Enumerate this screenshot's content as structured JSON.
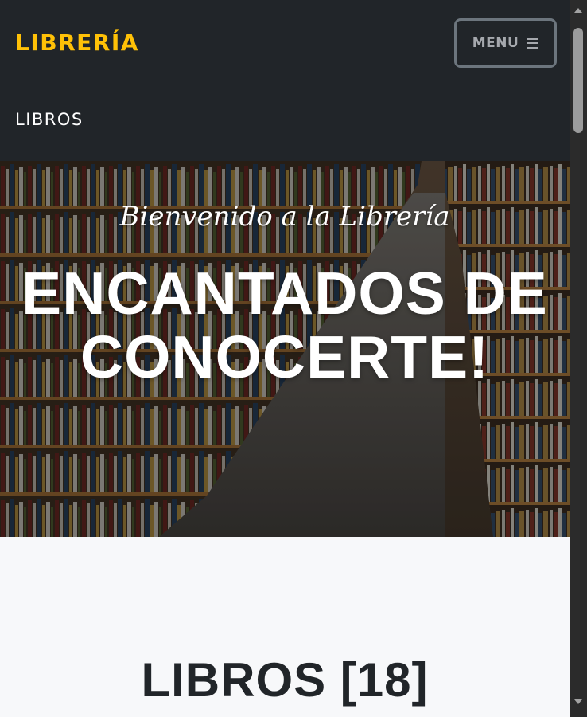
{
  "navbar": {
    "brand": "LIBRERÍA",
    "menu_label": "MENU",
    "menu_icon": "hamburger-icon",
    "links": [
      {
        "label": "LIBROS"
      }
    ]
  },
  "hero": {
    "subtitle": "Bienvenido a la Librería",
    "heading": "ENCANTADOS DE CONOCERTE!",
    "background": "bookstore aisle with shelves"
  },
  "section": {
    "title": "LIBROS [18]"
  },
  "colors": {
    "navbar_bg": "#212529",
    "brand": "#ffc107",
    "menu_border": "#6c757d",
    "section_bg": "#f7f8fa",
    "heading_text": "#212529",
    "scrollbar_bg": "#2b2b2b",
    "scrollbar_thumb": "#9c9c9c"
  }
}
